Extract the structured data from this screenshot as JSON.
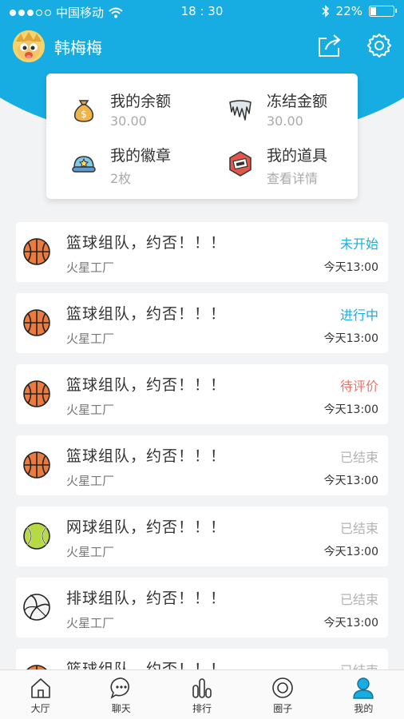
{
  "statusbar": {
    "carrier": "中国移动",
    "time": "18 : 30",
    "battery": "22%",
    "battery_level": 0.22
  },
  "profile": {
    "name": "韩梅梅"
  },
  "wallet": {
    "balance": {
      "label": "我的余额",
      "value": "30.00",
      "icon": "money-bag-icon"
    },
    "frozen": {
      "label": "冻结金额",
      "value": "30.00",
      "icon": "ice-icon"
    },
    "badges": {
      "label": "我的徽章",
      "value": "2枚",
      "icon": "badge-cap-icon"
    },
    "props": {
      "label": "我的道具",
      "value": "查看详情",
      "icon": "prop-ticket-icon"
    }
  },
  "activities": [
    {
      "title": "篮球组队，约否！！！",
      "organizer": "火星工厂",
      "status": "未开始",
      "status_color": "#17ade2",
      "time": "今天13:00",
      "sport": "basketball"
    },
    {
      "title": "篮球组队，约否！！！",
      "organizer": "火星工厂",
      "status": "进行中",
      "status_color": "#17ade2",
      "time": "今天13:00",
      "sport": "basketball"
    },
    {
      "title": "篮球组队，约否！！！",
      "organizer": "火星工厂",
      "status": "待评价",
      "status_color": "#f07167",
      "time": "今天13:00",
      "sport": "basketball"
    },
    {
      "title": "篮球组队，约否！！！",
      "organizer": "火星工厂",
      "status": "已结束",
      "status_color": "#b3b3b3",
      "time": "今天13:00",
      "sport": "basketball"
    },
    {
      "title": "网球组队，约否！！！",
      "organizer": "火星工厂",
      "status": "已结束",
      "status_color": "#b3b3b3",
      "time": "今天13:00",
      "sport": "tennis"
    },
    {
      "title": "排球组队，约否！！！",
      "organizer": "火星工厂",
      "status": "已结束",
      "status_color": "#b3b3b3",
      "time": "今天13:00",
      "sport": "volleyball"
    },
    {
      "title": "篮球组队，约否！！！",
      "organizer": "",
      "status": "已结束",
      "status_color": "#b3b3b3",
      "time": "",
      "sport": "basketball"
    }
  ],
  "tabs": [
    {
      "label": "大厅",
      "icon": "home-icon"
    },
    {
      "label": "聊天",
      "icon": "chat-icon"
    },
    {
      "label": "排行",
      "icon": "ranking-icon"
    },
    {
      "label": "圈子",
      "icon": "circle-icon"
    },
    {
      "label": "我的",
      "icon": "user-icon",
      "active": true
    }
  ],
  "colors": {
    "accent": "#17ade2",
    "pending_review": "#f07167",
    "ended": "#b3b3b3"
  }
}
